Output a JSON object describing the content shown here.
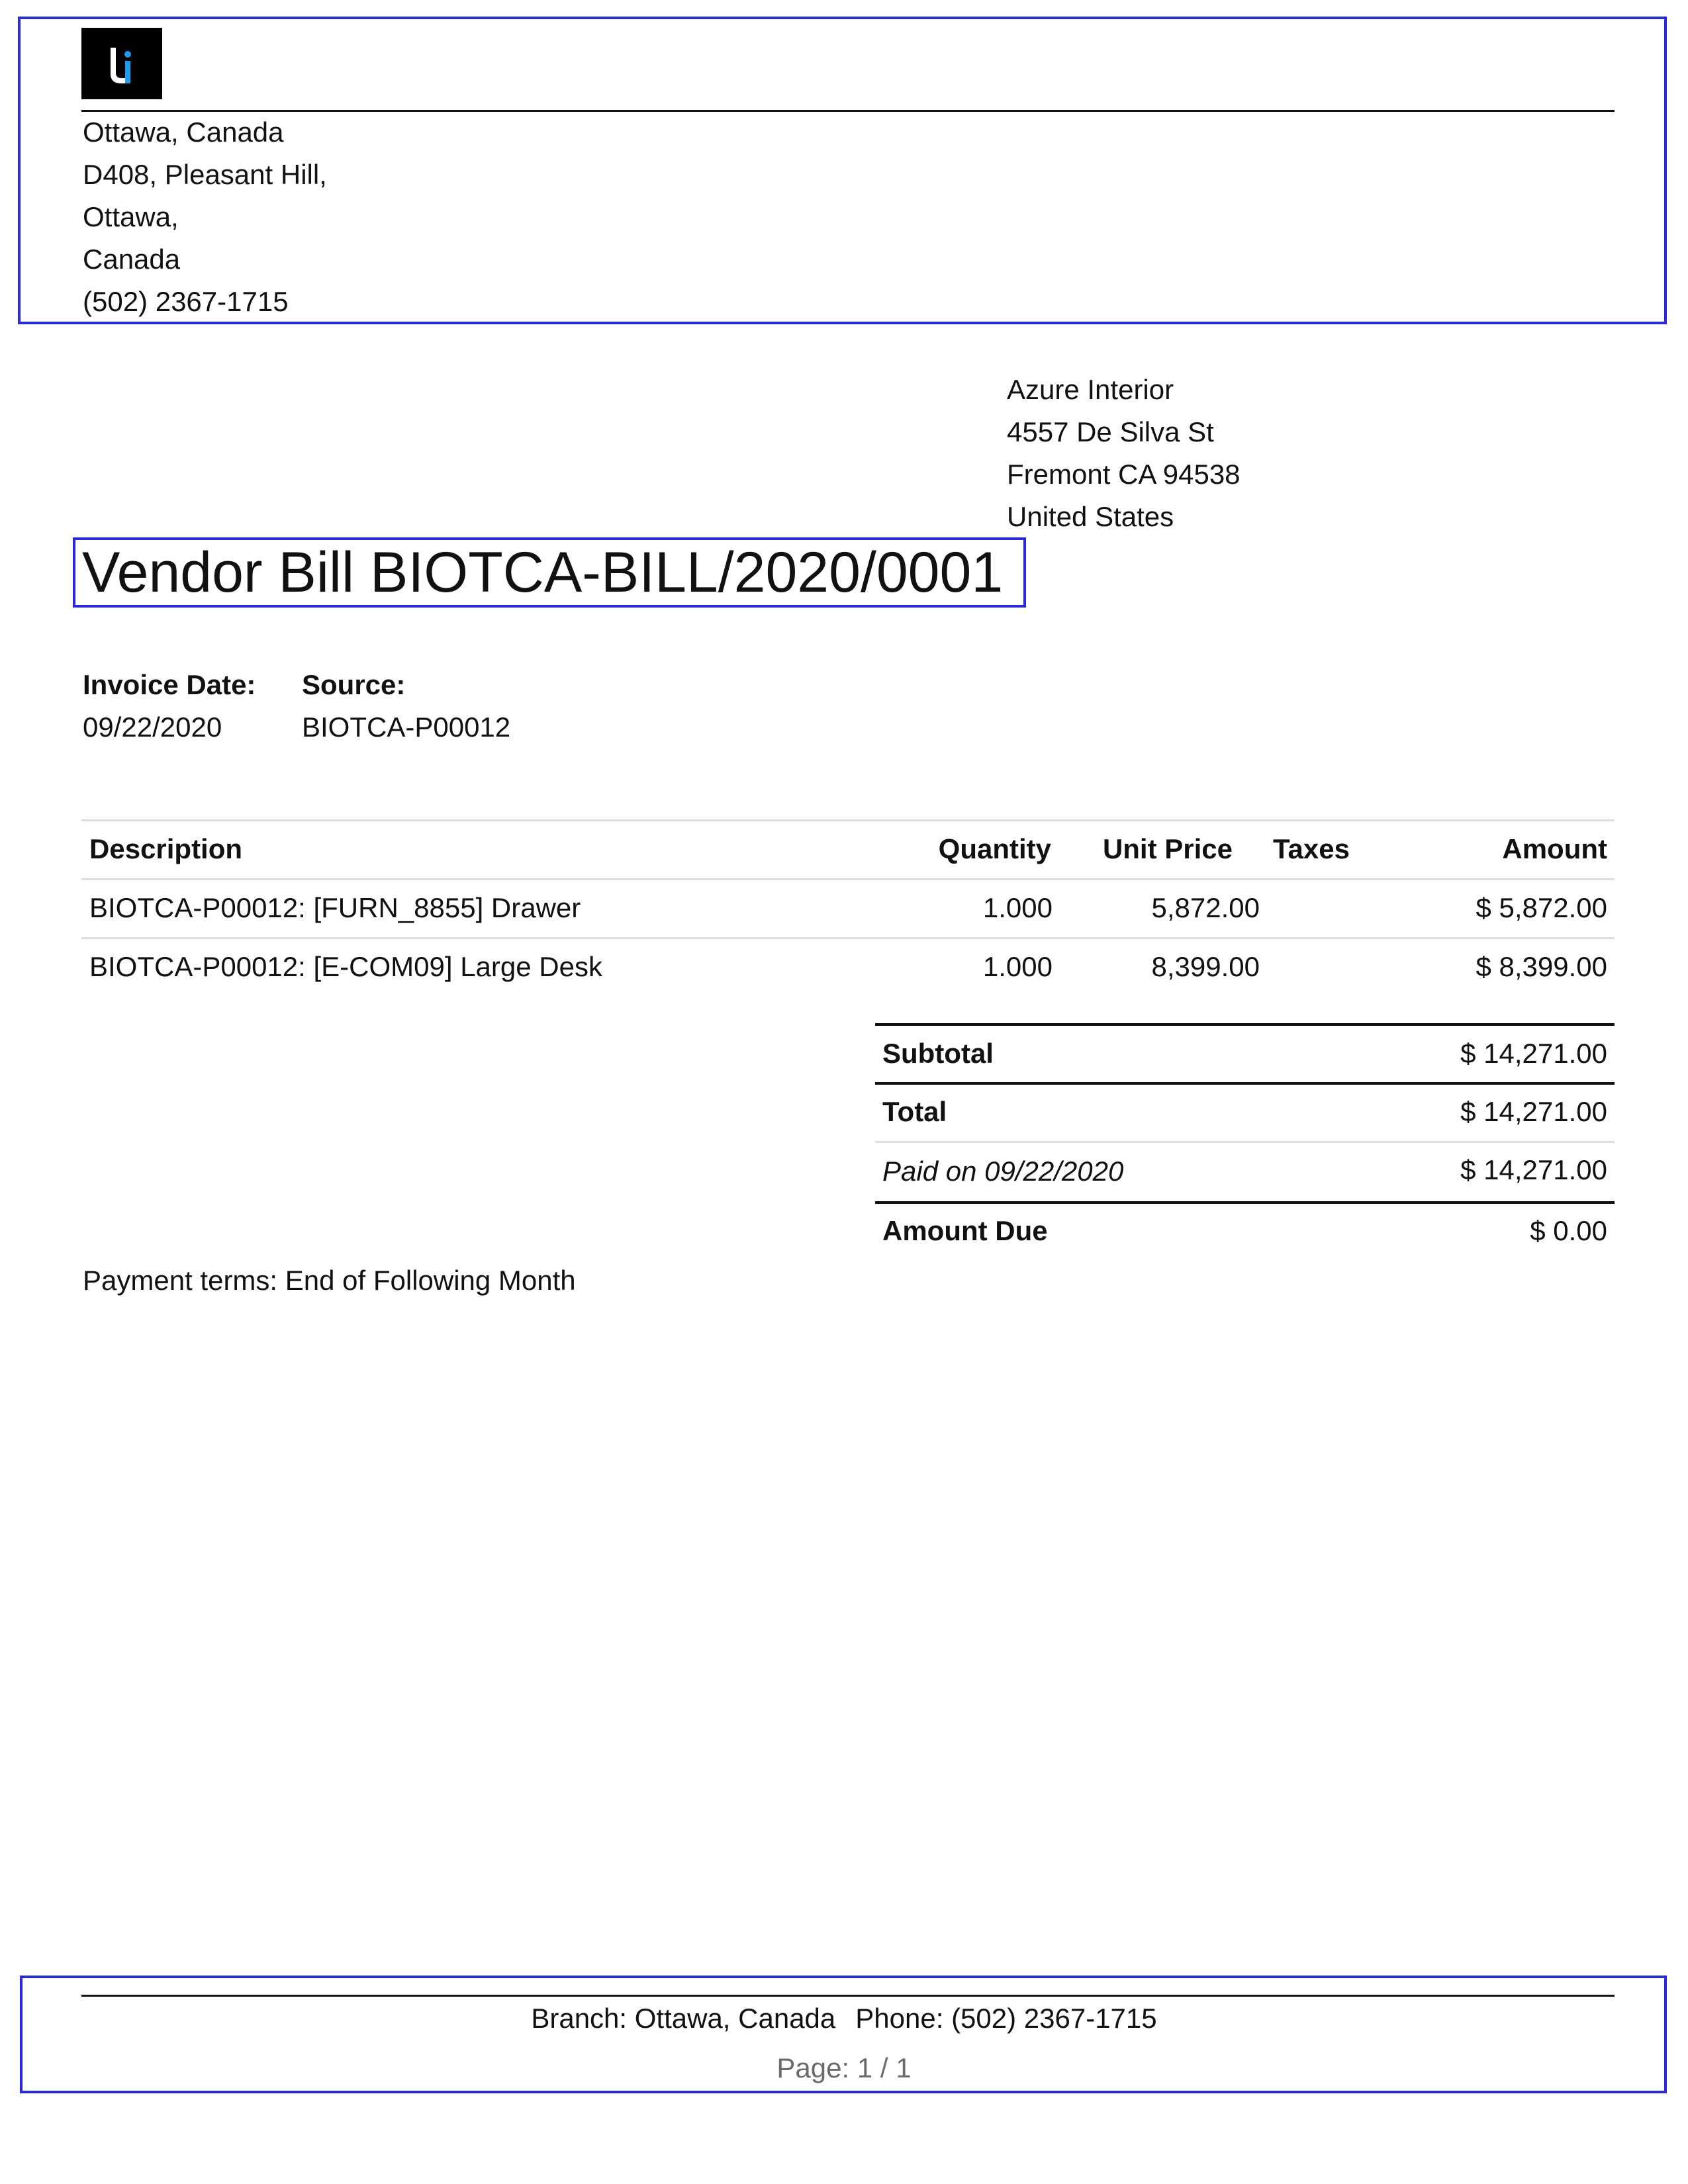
{
  "company": {
    "address_lines": [
      "Ottawa, Canada",
      "D408, Pleasant Hill,",
      "Ottawa,",
      "Canada",
      "(502) 2367-1715"
    ],
    "logo_icon": "company-logo-icon",
    "logo_colors": {
      "background": "#000000",
      "letter_white": "#ffffff",
      "letter_blue": "#1e9df0"
    }
  },
  "vendor": {
    "address_lines": [
      "Azure Interior",
      "4557 De Silva St",
      "Fremont CA 94538",
      "United States"
    ]
  },
  "document": {
    "title": "Vendor Bill BIOTCA-BILL/2020/0001"
  },
  "info": {
    "invoice_date_label": "Invoice Date:",
    "invoice_date_value": "09/22/2020",
    "source_label": "Source:",
    "source_value": "BIOTCA-P00012"
  },
  "lines_table": {
    "headers": {
      "description": "Description",
      "quantity": "Quantity",
      "unit_price": "Unit Price",
      "taxes": "Taxes",
      "amount": "Amount"
    },
    "rows": [
      {
        "description": "BIOTCA-P00012: [FURN_8855] Drawer",
        "quantity": "1.000",
        "unit_price": "5,872.00",
        "taxes": "",
        "amount": "$ 5,872.00"
      },
      {
        "description": "BIOTCA-P00012: [E-COM09] Large Desk",
        "quantity": "1.000",
        "unit_price": "8,399.00",
        "taxes": "",
        "amount": "$ 8,399.00"
      }
    ]
  },
  "totals": {
    "subtotal_label": "Subtotal",
    "subtotal_value": "$ 14,271.00",
    "total_label": "Total",
    "total_value": "$ 14,271.00",
    "paid_label": "Paid on 09/22/2020",
    "paid_value": "$ 14,271.00",
    "amount_due_label": "Amount Due",
    "amount_due_value": "$ 0.00"
  },
  "payment_terms": "Payment terms: End of Following Month",
  "footer": {
    "branch": "Branch: Ottawa, Canada",
    "phone": "Phone: (502) 2367-1715",
    "page": "Page: 1 / 1"
  },
  "accent_colors": {
    "frame_blue": "#2a2ad8"
  }
}
